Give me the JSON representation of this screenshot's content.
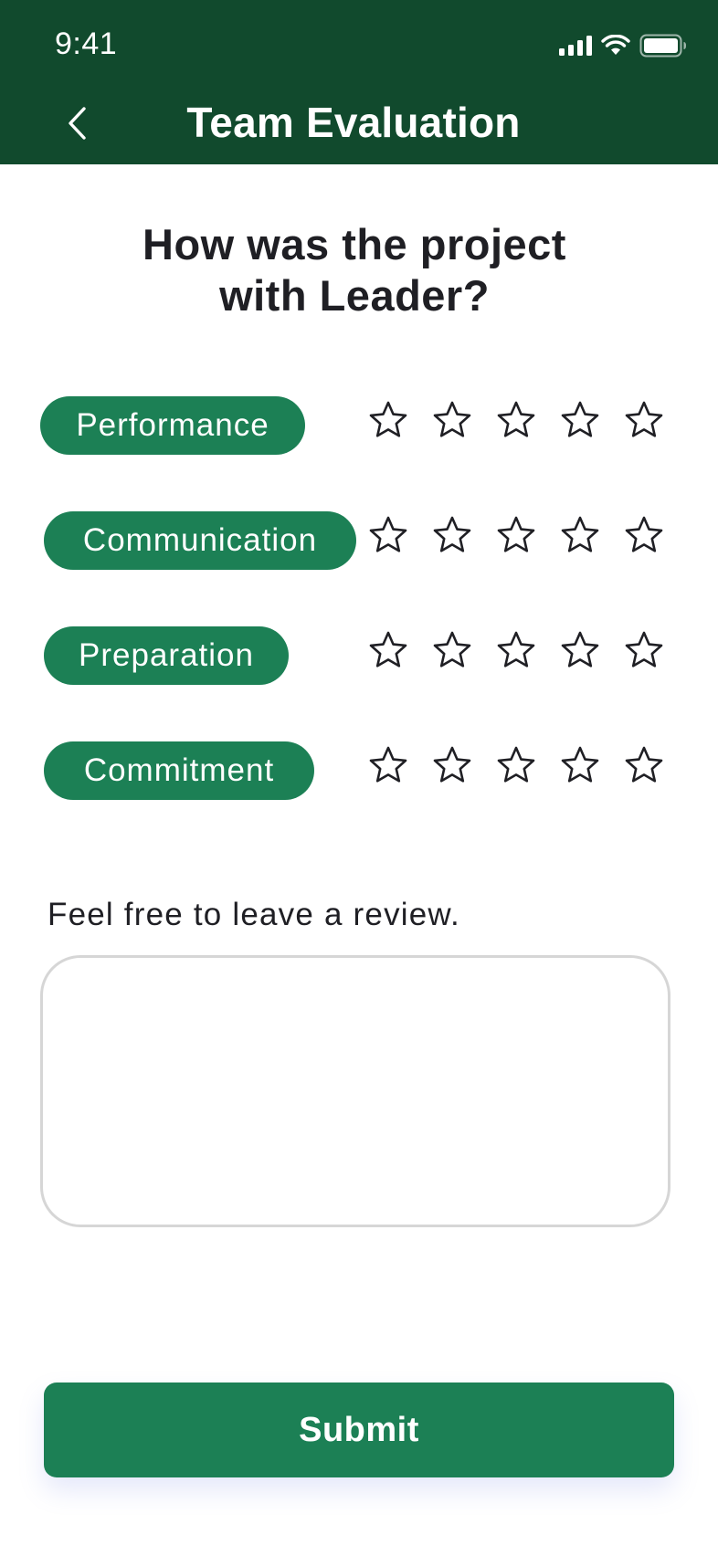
{
  "status_bar": {
    "time": "9:41",
    "icons": [
      "cellular-signal-icon",
      "wifi-icon",
      "battery-icon"
    ]
  },
  "header": {
    "back_icon": "chevron-left-icon",
    "title": "Team Evaluation",
    "background": "#114a2d"
  },
  "question": {
    "line1": "How was the project",
    "line2": "with Leader?"
  },
  "ratings": [
    {
      "label": "Performance",
      "stars_selected": 0,
      "stars_total": 5
    },
    {
      "label": "Communication",
      "stars_selected": 0,
      "stars_total": 5
    },
    {
      "label": "Preparation",
      "stars_selected": 0,
      "stars_total": 5
    },
    {
      "label": "Commitment",
      "stars_selected": 0,
      "stars_total": 5
    }
  ],
  "review": {
    "label": "Feel free to leave a review.",
    "value": "",
    "placeholder": ""
  },
  "submit": {
    "label": "Submit"
  },
  "colors": {
    "accent": "#1c8055",
    "header": "#114a2d",
    "text": "#1f1f24",
    "border": "#d6d6d6"
  }
}
